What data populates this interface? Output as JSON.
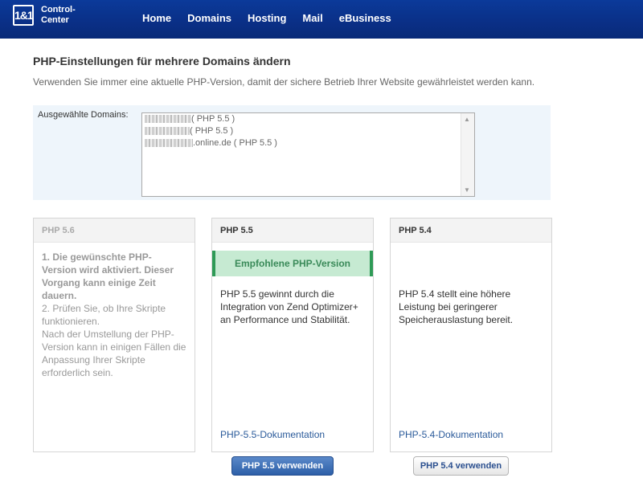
{
  "header": {
    "logo": "1&1",
    "logo_text": "Control-\nCenter",
    "nav": [
      "Home",
      "Domains",
      "Hosting",
      "Mail",
      "eBusiness"
    ]
  },
  "page": {
    "title": "PHP-Einstellungen für mehrere Domains ändern",
    "subtitle": "Verwenden Sie immer eine aktuelle PHP-Version, damit der sichere Betrieb Ihrer Website gewährleistet werden kann."
  },
  "domains": {
    "label": "Ausgewählte Domains:",
    "items": [
      {
        "suffix": "( PHP 5.5 )"
      },
      {
        "suffix": "( PHP 5.5 )"
      },
      {
        "suffix": ".online.de ( PHP 5.5 )"
      }
    ]
  },
  "cards": [
    {
      "title": "PHP 5.6",
      "text_bold": "1. Die gewünschte PHP-Version wird aktiviert. Dieser Vorgang kann einige Zeit dauern.",
      "text": "2. Prüfen Sie, ob Ihre Skripte funktionieren.\nNach der Umstellung der PHP-Version kann in einigen Fällen die Anpassung Ihrer Skripte erforderlich sein."
    },
    {
      "title": "PHP 5.5",
      "recommended": "Empfohlene PHP-Version",
      "text": "PHP 5.5 gewinnt durch die Integration von Zend Optimizer+ an Performance und Stabilität.",
      "doc": "PHP-5.5-Dokumentation"
    },
    {
      "title": "PHP 5.4",
      "text": "PHP 5.4 stellt eine höhere Leistung bei geringerer Speicherauslastung bereit.",
      "doc": "PHP-5.4-Dokumentation"
    }
  ],
  "buttons": {
    "use55": "PHP 5.5 verwenden",
    "use54": "PHP 5.4 verwenden"
  },
  "colors": {
    "header": "#0a2f86",
    "recommended_bg": "#c6ead2",
    "recommended_border": "#2e9a56",
    "link": "#2a5a9a"
  }
}
